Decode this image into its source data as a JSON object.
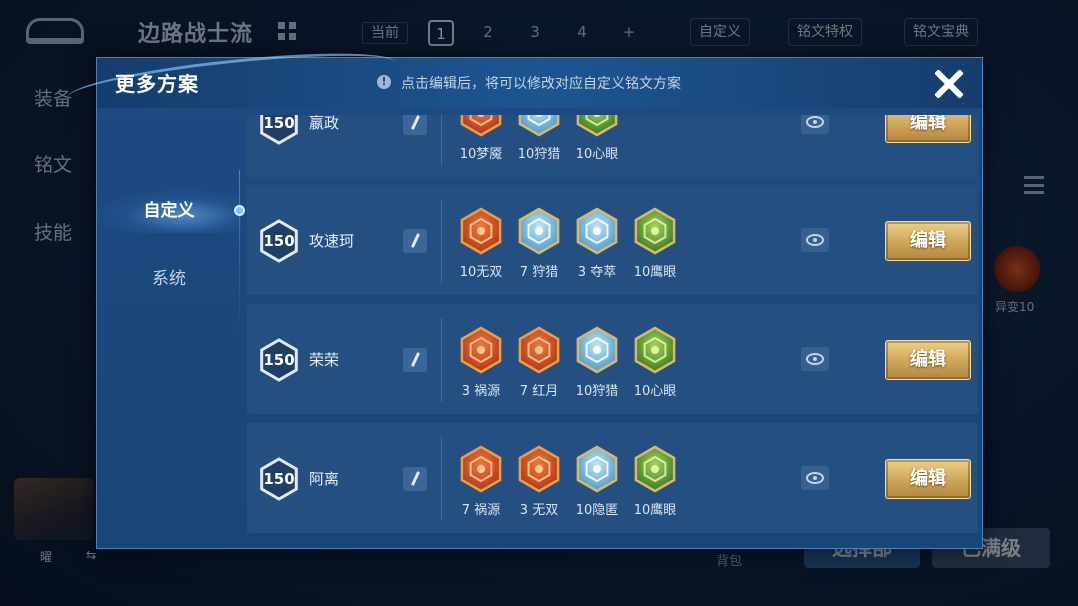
{
  "background": {
    "build_title": "边路战士流",
    "current_label": "当前",
    "slots": [
      "1",
      "2",
      "3",
      "4",
      "+"
    ],
    "active_slot": "1",
    "custom_button": "自定义",
    "rune_privilege": "铭文特权",
    "rune_codex": "铭文宝典",
    "side_tabs": [
      "装备",
      "铭文",
      "技能"
    ],
    "side_rune_label": "异变10",
    "hero_name": "曜",
    "bag_label": "背包",
    "select_button": "选择部",
    "max_level_button": "已满级"
  },
  "modal": {
    "title": "更多方案",
    "hint": "点击编辑后，将可以修改对应自定义铭文方案",
    "nav": [
      {
        "label": "自定义",
        "active": true
      },
      {
        "label": "系统",
        "active": false
      }
    ],
    "edit_label": "编辑",
    "rows": [
      {
        "level": "150",
        "name": "嬴政",
        "runes": [
          {
            "label": "10梦魇",
            "color": "red",
            "icon": "nightmare-rune"
          },
          {
            "label": "10狩猎",
            "color": "blue",
            "icon": "hunt-rune"
          },
          {
            "label": "10心眼",
            "color": "green",
            "icon": "mind-eye-rune"
          }
        ]
      },
      {
        "level": "150",
        "name": "攻速珂",
        "runes": [
          {
            "label": "10无双",
            "color": "red",
            "icon": "peerless-rune"
          },
          {
            "label": "7 狩猎",
            "color": "blue",
            "icon": "hunt-rune"
          },
          {
            "label": "3 夺萃",
            "color": "blue",
            "icon": "extract-rune"
          },
          {
            "label": "10鹰眼",
            "color": "green",
            "icon": "hawk-eye-rune"
          }
        ]
      },
      {
        "level": "150",
        "name": "荣荣",
        "runes": [
          {
            "label": "3 祸源",
            "color": "red",
            "icon": "calamity-rune"
          },
          {
            "label": "7 红月",
            "color": "red",
            "icon": "red-moon-rune"
          },
          {
            "label": "10狩猎",
            "color": "blue",
            "icon": "hunt-rune"
          },
          {
            "label": "10心眼",
            "color": "green",
            "icon": "mind-eye-rune"
          }
        ]
      },
      {
        "level": "150",
        "name": "阿离",
        "runes": [
          {
            "label": "7 祸源",
            "color": "red",
            "icon": "calamity-rune"
          },
          {
            "label": "3 无双",
            "color": "red",
            "icon": "peerless-rune"
          },
          {
            "label": "10隐匿",
            "color": "blue",
            "icon": "stealth-rune"
          },
          {
            "label": "10鹰眼",
            "color": "green",
            "icon": "hawk-eye-rune"
          }
        ]
      }
    ]
  },
  "colors": {
    "modal_bg": "#1c4a82",
    "row_bg": "#254f80",
    "edit_button_gold": "#d1a85a",
    "rune_red": "#d4542a",
    "rune_blue": "#6fb6e0",
    "rune_green": "#6aa83a"
  }
}
